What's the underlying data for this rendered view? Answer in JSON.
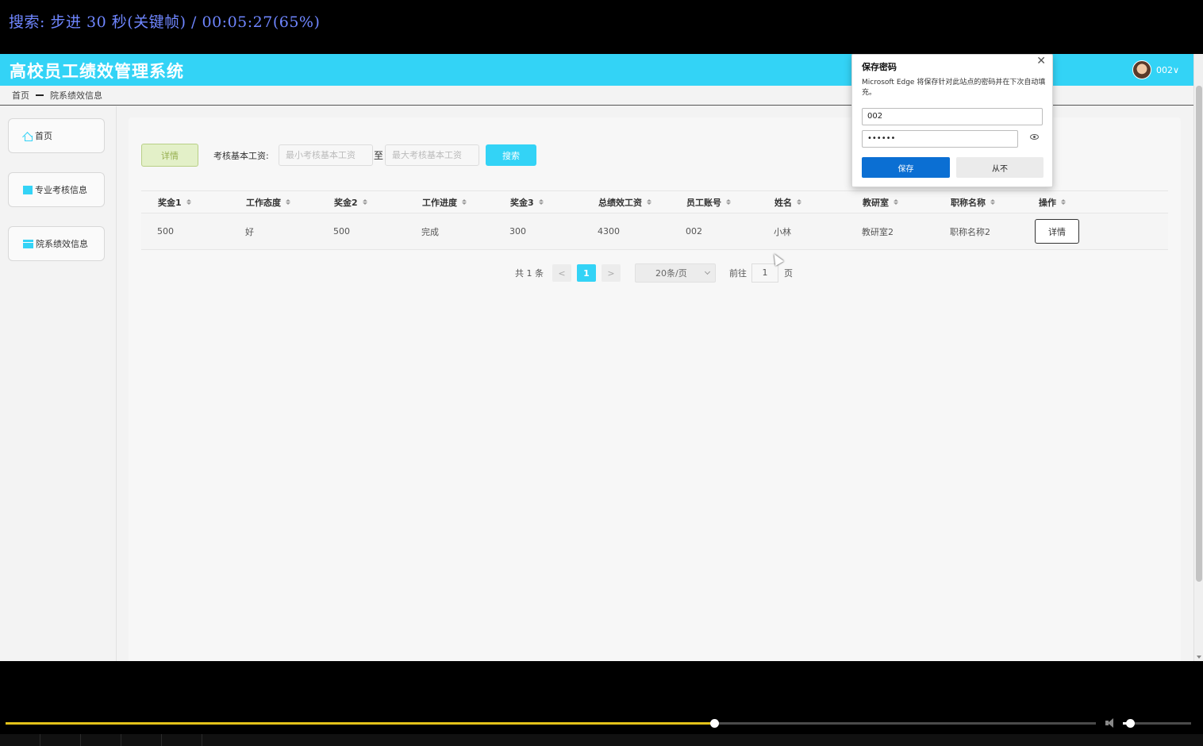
{
  "player": {
    "osd_text": "搜索: 步进 30 秒(关键帧) / 00:05:27(65%)",
    "seek_fraction": 0.65,
    "volume_fraction": 0.1
  },
  "app": {
    "title": "高校员工绩效管理系统",
    "user": "002∨"
  },
  "breadcrumb": {
    "home": "首页",
    "current": "院系绩效信息"
  },
  "sidebar": {
    "items": [
      {
        "label": "首页",
        "icon": "home-icon"
      },
      {
        "label": "专业考核信息",
        "icon": "block-icon"
      },
      {
        "label": "院系绩效信息",
        "icon": "table-icon"
      }
    ]
  },
  "toolbar": {
    "detail_label": "详情",
    "search_label": "考核基本工资:",
    "min_placeholder": "最小考核基本工资",
    "to_label": "至",
    "max_placeholder": "最大考核基本工资",
    "search_button": "搜索"
  },
  "table": {
    "headers": [
      "奖金1",
      "工作态度",
      "奖金2",
      "工作进度",
      "奖金3",
      "总绩效工资",
      "员工账号",
      "姓名",
      "教研室",
      "职称名称",
      "操作"
    ],
    "rows": [
      {
        "cells": [
          "500",
          "好",
          "500",
          "完成",
          "300",
          "4300",
          "002",
          "小林",
          "教研室2",
          "职称名称2"
        ],
        "action": "详情"
      }
    ]
  },
  "pagination": {
    "total": "共 1 条",
    "prev": "<",
    "current_page": "1",
    "next": ">",
    "page_size": "20条/页",
    "goto_label": "前往",
    "goto_value": "1",
    "page_suffix": "页"
  },
  "password_dialog": {
    "title": "保存密码",
    "description": "Microsoft Edge 将保存针对此站点的密码并在下次自动填充。",
    "username": "002",
    "password": "••••••",
    "save_button": "保存",
    "never_button": "从不",
    "close_glyph": "✕"
  },
  "colors": {
    "accent": "#33d3f6",
    "edge_blue": "#0b6fd3",
    "seek": "#e3c21a",
    "osd": "#6f86ff"
  }
}
